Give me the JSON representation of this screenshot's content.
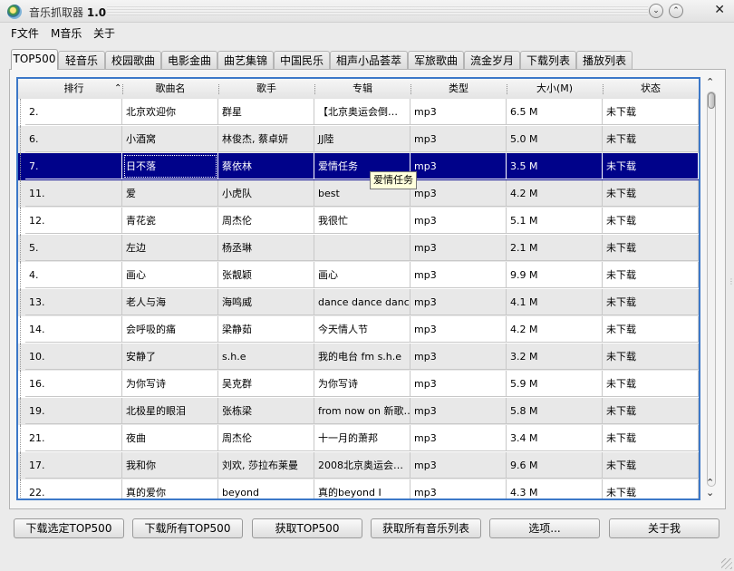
{
  "window": {
    "title": "音乐抓取器",
    "version": "1.0"
  },
  "menu": [
    {
      "label": "F文件"
    },
    {
      "label": "M音乐"
    },
    {
      "label": "关于"
    }
  ],
  "tabs": [
    {
      "label": "TOP500",
      "active": true
    },
    {
      "label": "轻音乐"
    },
    {
      "label": "校园歌曲"
    },
    {
      "label": "电影金曲"
    },
    {
      "label": "曲艺集锦"
    },
    {
      "label": "中国民乐"
    },
    {
      "label": "相声小品荟萃"
    },
    {
      "label": "军旅歌曲"
    },
    {
      "label": "流金岁月"
    },
    {
      "label": "下载列表"
    },
    {
      "label": "播放列表"
    }
  ],
  "table": {
    "columns": [
      "排行",
      "歌曲名",
      "歌手",
      "专辑",
      "类型",
      "大小(M)",
      "状态"
    ],
    "sort_column": "排行",
    "selected_row": 2,
    "rows": [
      [
        "2.",
        "北京欢迎你",
        "群星",
        "【北京奥运会倒…",
        "mp3",
        "6.5 M",
        "未下载"
      ],
      [
        "6.",
        "小酒窝",
        "林俊杰, 蔡卓妍",
        "JJ陸",
        "mp3",
        "5.0 M",
        "未下载"
      ],
      [
        "7.",
        "日不落",
        "蔡依林",
        "爱情任务",
        "mp3",
        "3.5 M",
        "未下载"
      ],
      [
        "11.",
        "爱",
        "小虎队",
        "best",
        "mp3",
        "4.2 M",
        "未下载"
      ],
      [
        "12.",
        "青花瓷",
        "周杰伦",
        "我很忙",
        "mp3",
        "5.1 M",
        "未下载"
      ],
      [
        "5.",
        "左边",
        "杨丞琳",
        "",
        "mp3",
        "2.1 M",
        "未下载"
      ],
      [
        "4.",
        "画心",
        "张靓颖",
        "画心",
        "mp3",
        "9.9 M",
        "未下载"
      ],
      [
        "13.",
        "老人与海",
        "海鸣威",
        "dance dance dance",
        "mp3",
        "4.1 M",
        "未下载"
      ],
      [
        "14.",
        "会呼吸的痛",
        "梁静茹",
        "今天情人节",
        "mp3",
        "4.2 M",
        "未下载"
      ],
      [
        "10.",
        "安静了",
        "s.h.e",
        "我的电台 fm s.h.e",
        "mp3",
        "3.2 M",
        "未下载"
      ],
      [
        "16.",
        "为你写诗",
        "吴克群",
        "为你写诗",
        "mp3",
        "5.9 M",
        "未下载"
      ],
      [
        "19.",
        "北极星的眼泪",
        "张栋梁",
        "from now on 新歌…",
        "mp3",
        "5.8 M",
        "未下载"
      ],
      [
        "21.",
        "夜曲",
        "周杰伦",
        "十一月的萧邦",
        "mp3",
        "3.4 M",
        "未下载"
      ],
      [
        "17.",
        "我和你",
        "刘欢, 莎拉布莱曼",
        "2008北京奥运会…",
        "mp3",
        "9.6 M",
        "未下载"
      ],
      [
        "22.",
        "真的爱你",
        "beyond",
        "真的beyond Ⅰ",
        "mp3",
        "4.3 M",
        "未下载"
      ]
    ]
  },
  "tooltip": "爱情任务",
  "buttons": [
    {
      "label": "下载选定TOP500"
    },
    {
      "label": "下载所有TOP500"
    },
    {
      "label": "获取TOP500"
    },
    {
      "label": "获取所有音乐列表"
    },
    {
      "label": "选项..."
    },
    {
      "label": "关于我"
    }
  ],
  "colors": {
    "selection": "#00028a",
    "frame": "#3c78c8",
    "alt_row": "#e8e8e8",
    "tooltip_bg": "#ffffdc"
  },
  "icons": [
    "app-icon",
    "minimize-icon",
    "maximize-icon",
    "close-icon",
    "sort-ascending-icon",
    "scroll-up-icon",
    "scroll-down-icon"
  ]
}
